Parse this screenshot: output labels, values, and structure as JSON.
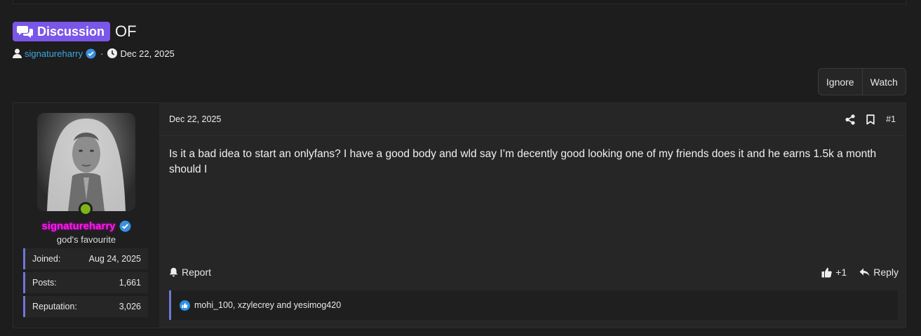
{
  "thread": {
    "prefix": "Discussion",
    "title": "OF",
    "author": "signatureharry",
    "separator": "·",
    "date": "Dec 22, 2025"
  },
  "actions": {
    "ignore": "Ignore",
    "watch": "Watch"
  },
  "user": {
    "username": "signatureharry",
    "user_title": "god's favourite",
    "stats": [
      {
        "label": "Joined:",
        "value": "Aug 24, 2025"
      },
      {
        "label": "Posts:",
        "value": "1,661"
      },
      {
        "label": "Reputation:",
        "value": "3,026"
      }
    ]
  },
  "post": {
    "date": "Dec 22, 2025",
    "number": "#1",
    "body": "Is it a bad idea to start an onlyfans? I have a good body and wld say I’m decently good looking one of my friends does it and he earns 1.5k a month should I",
    "report": "Report",
    "like_count": "+1",
    "reply": "Reply",
    "reactions_text": "mohi_100, xzylecrey and yesimog420"
  },
  "colors": {
    "prefix_badge": "#7a57e8",
    "author_link": "#3aa9e0",
    "username": "#ff1ae8",
    "online": "#7cb518",
    "accent_border": "#7176d6",
    "verified": "#3b8fe0"
  },
  "icons": [
    "comments-icon",
    "user-icon",
    "verified-icon",
    "clock-icon",
    "share-icon",
    "bookmark-icon",
    "bell-icon",
    "thumbs-up-icon",
    "reply-icon",
    "like-reaction-icon"
  ]
}
